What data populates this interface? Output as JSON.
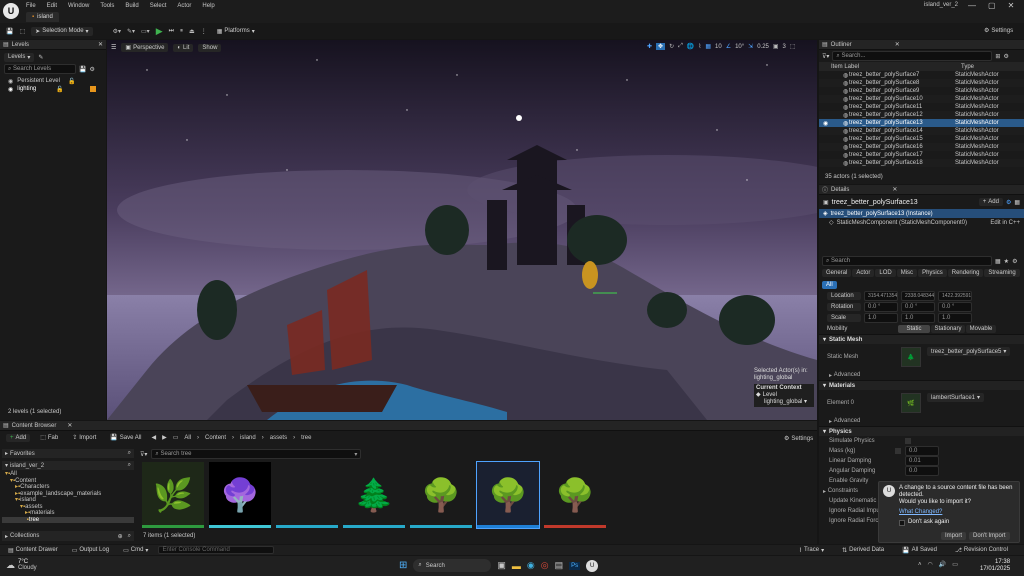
{
  "app": {
    "project_tab": "island",
    "window_title": "island_ver_2",
    "menu": [
      "File",
      "Edit",
      "Window",
      "Tools",
      "Build",
      "Select",
      "Actor",
      "Help"
    ]
  },
  "toolbar": {
    "mode": "Selection Mode",
    "platforms": "Platforms",
    "settings": "Settings"
  },
  "levels": {
    "tab": "Levels",
    "add": "Levels",
    "search_placeholder": "Search Levels",
    "rows": [
      "Persistent Level",
      "lighting"
    ],
    "status": "2 levels (1 selected)"
  },
  "viewport": {
    "perspective": "Perspective",
    "lit": "Lit",
    "show": "Show",
    "snap_rot": "10",
    "snap_angle": "10°",
    "snap_scale": "0.25",
    "cam_speed": "3",
    "selected_info": "Selected Actor(s) in:",
    "selected_level": "lighting_global",
    "current_context": "Current Context",
    "level_label": "Level",
    "level_value": "lighting_global"
  },
  "outliner": {
    "tab": "Outliner",
    "search_placeholder": "Search...",
    "col_label": "Item Label",
    "col_type": "Type",
    "rows": [
      {
        "name": "treez_better_polySurface7",
        "type": "StaticMeshActor"
      },
      {
        "name": "treez_better_polySurface8",
        "type": "StaticMeshActor"
      },
      {
        "name": "treez_better_polySurface9",
        "type": "StaticMeshActor"
      },
      {
        "name": "treez_better_polySurface10",
        "type": "StaticMeshActor"
      },
      {
        "name": "treez_better_polySurface11",
        "type": "StaticMeshActor"
      },
      {
        "name": "treez_better_polySurface12",
        "type": "StaticMeshActor"
      },
      {
        "name": "treez_better_polySurface13",
        "type": "StaticMeshActor"
      },
      {
        "name": "treez_better_polySurface14",
        "type": "StaticMeshActor"
      },
      {
        "name": "treez_better_polySurface15",
        "type": "StaticMeshActor"
      },
      {
        "name": "treez_better_polySurface16",
        "type": "StaticMeshActor"
      },
      {
        "name": "treez_better_polySurface17",
        "type": "StaticMeshActor"
      },
      {
        "name": "treez_better_polySurface18",
        "type": "StaticMeshActor"
      }
    ],
    "selected_index": 6,
    "status": "35 actors (1 selected)"
  },
  "details": {
    "tab": "Details",
    "actor": "treez_better_polySurface13",
    "add": "Add",
    "instance": "treez_better_polySurface13 (Instance)",
    "component": "StaticMeshComponent (StaticMeshComponent0)",
    "edit_cpp": "Edit in C++",
    "search_placeholder": "Search",
    "filters": [
      "General",
      "Actor",
      "LOD",
      "Misc",
      "Physics",
      "Rendering",
      "Streaming",
      "All"
    ],
    "location_label": "Location",
    "location": [
      "3154.471354",
      "2338.048344",
      "1422.392591"
    ],
    "rotation_label": "Rotation",
    "rotation": [
      "0.0 °",
      "0.0 °",
      "0.0 °"
    ],
    "scale_label": "Scale",
    "scale": [
      "1.0",
      "1.0",
      "1.0"
    ],
    "mobility_label": "Mobility",
    "mobility": [
      "Static",
      "Stationary",
      "Movable"
    ],
    "static_mesh_cat": "Static Mesh",
    "static_mesh_label": "Static Mesh",
    "static_mesh_value": "treez_better_polySurface5",
    "advanced": "Advanced",
    "materials_cat": "Materials",
    "element_label": "Element 0",
    "element_value": "lambertSurface1",
    "physics_cat": "Physics",
    "physics_props": [
      "Simulate Physics",
      "Mass (kg)",
      "Linear Damping",
      "Angular Damping",
      "Enable Gravity",
      "Constraints",
      "Update Kinematic from Sim",
      "Ignore Radial Impulse",
      "Ignore Radial Force"
    ],
    "mass_value": "0.0",
    "linear_damping": "0.01",
    "angular_damping": "0.0"
  },
  "toast": {
    "title": "A change to a source content file has been detected.",
    "question": "Would you like to import it?",
    "link": "What Changed?",
    "checkbox": "Don't ask again",
    "import": "Import",
    "dont_import": "Don't Import"
  },
  "content_browser": {
    "tab": "Content Browser",
    "add": "Add",
    "fab": "Fab",
    "import": "Import",
    "save_all": "Save All",
    "path": [
      "All",
      "Content",
      "island",
      "assets",
      "tree"
    ],
    "settings": "Settings",
    "search_placeholder": "Search tree",
    "favorites": "Favorites",
    "project": "island_ver_2",
    "tree": [
      "All",
      "Content",
      "Characters",
      "example_landscape_materials",
      "island",
      "assets",
      "materials",
      "tree"
    ],
    "status": "7 items (1 selected)",
    "collections": "Collections"
  },
  "statusbar": {
    "content_drawer": "Content Drawer",
    "output_log": "Output Log",
    "cmd": "Cmd",
    "console_placeholder": "Enter Console Command",
    "trace": "Trace",
    "derived": "Derived Data",
    "saved": "All Saved",
    "revision": "Revision Control"
  },
  "taskbar": {
    "temp": "7°C",
    "weather": "Cloudy",
    "search": "Search",
    "time": "17:38",
    "date": "17/01/2025"
  }
}
